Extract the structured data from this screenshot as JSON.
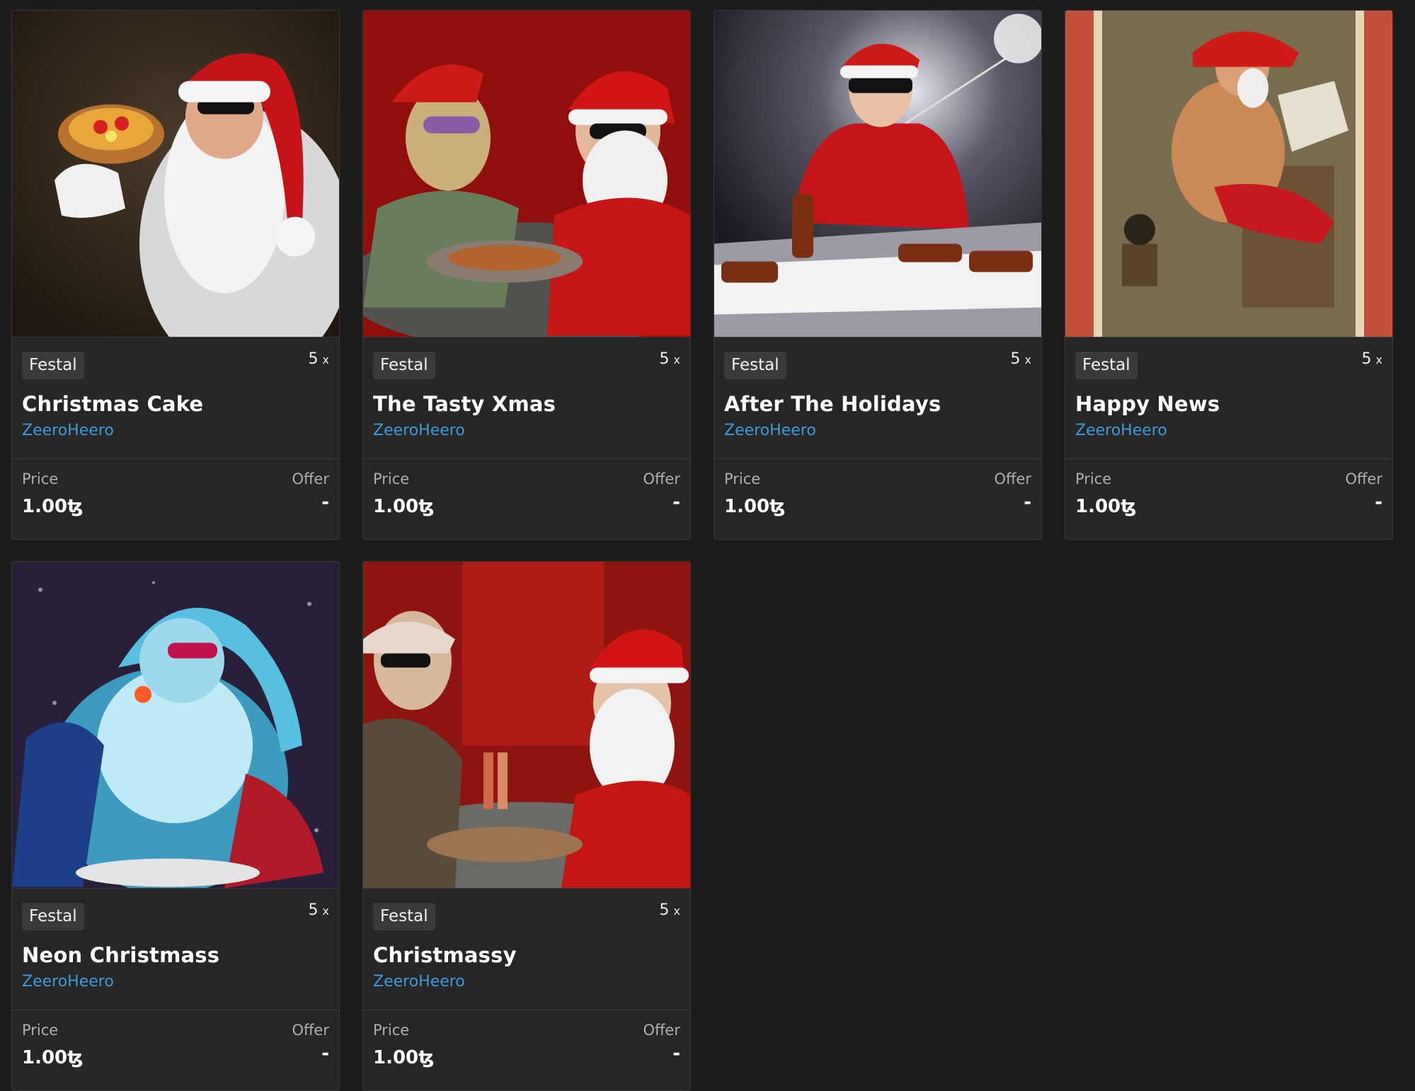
{
  "cards": [
    {
      "tag": "Festal",
      "editions": "5",
      "editions_suffix": "x",
      "title": "Christmas Cake",
      "author": "ZeeroHeero",
      "price_label": "Price",
      "price": "1.00ꜩ",
      "offer_label": "Offer",
      "offer": "-",
      "scene": "santa-pizza"
    },
    {
      "tag": "Festal",
      "editions": "5",
      "editions_suffix": "x",
      "title": "The Tasty Xmas",
      "author": "ZeeroHeero",
      "price_label": "Price",
      "price": "1.00ꜩ",
      "offer_label": "Offer",
      "offer": "-",
      "scene": "two-santas-red"
    },
    {
      "tag": "Festal",
      "editions": "5",
      "editions_suffix": "x",
      "title": "After The Holidays",
      "author": "ZeeroHeero",
      "price_label": "Price",
      "price": "1.00ꜩ",
      "offer_label": "Offer",
      "offer": "-",
      "scene": "man-skewers"
    },
    {
      "tag": "Festal",
      "editions": "5",
      "editions_suffix": "x",
      "title": "Happy News",
      "author": "ZeeroHeero",
      "price_label": "Price",
      "price": "1.00ꜩ",
      "offer_label": "Offer",
      "offer": "-",
      "scene": "santa-newspaper"
    },
    {
      "tag": "Festal",
      "editions": "5",
      "editions_suffix": "x",
      "title": "Neon Christmass",
      "author": "ZeeroHeero",
      "price_label": "Price",
      "price": "1.00ꜩ",
      "offer_label": "Offer",
      "offer": "-",
      "scene": "neon-santa"
    },
    {
      "tag": "Festal",
      "editions": "5",
      "editions_suffix": "x",
      "title": "Christmassy",
      "author": "ZeeroHeero",
      "price_label": "Price",
      "price": "1.00ꜩ",
      "offer_label": "Offer",
      "offer": "-",
      "scene": "santas-table"
    }
  ],
  "colors": {
    "background": "#1c1c1c",
    "card": "#262626",
    "author_link": "#3d9be0"
  }
}
